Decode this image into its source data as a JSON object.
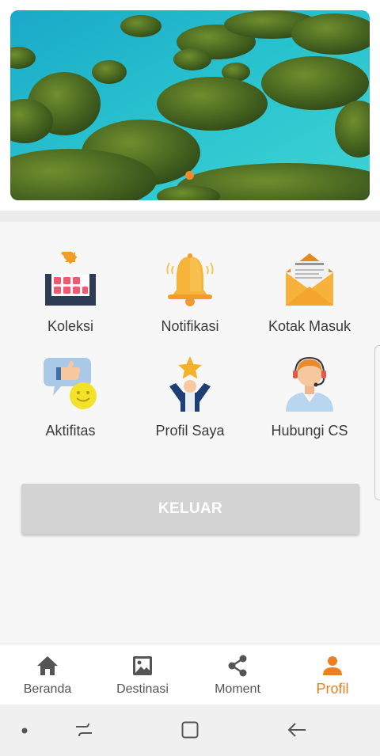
{
  "banner": {
    "image": "tropical-islands-lagoon",
    "active_slide": 1
  },
  "menu": {
    "items": [
      {
        "label": "Koleksi",
        "icon": "collection-icon"
      },
      {
        "label": "Notifikasi",
        "icon": "bell-icon"
      },
      {
        "label": "Kotak Masuk",
        "icon": "envelope-icon"
      },
      {
        "label": "Aktifitas",
        "icon": "activity-like-icon"
      },
      {
        "label": "Profil Saya",
        "icon": "profile-star-icon"
      },
      {
        "label": "Hubungi CS",
        "icon": "customer-service-icon"
      }
    ],
    "logout_label": "KELUAR"
  },
  "bottom_nav": {
    "items": [
      {
        "label": "Beranda",
        "icon": "home-icon"
      },
      {
        "label": "Destinasi",
        "icon": "image-icon"
      },
      {
        "label": "Moment",
        "icon": "share-icon"
      },
      {
        "label": "Profil",
        "icon": "person-icon",
        "active": true
      }
    ]
  },
  "colors": {
    "accent": "#ea7f24",
    "logout_bg": "#d3d3d3",
    "nav_text": "#555555"
  }
}
